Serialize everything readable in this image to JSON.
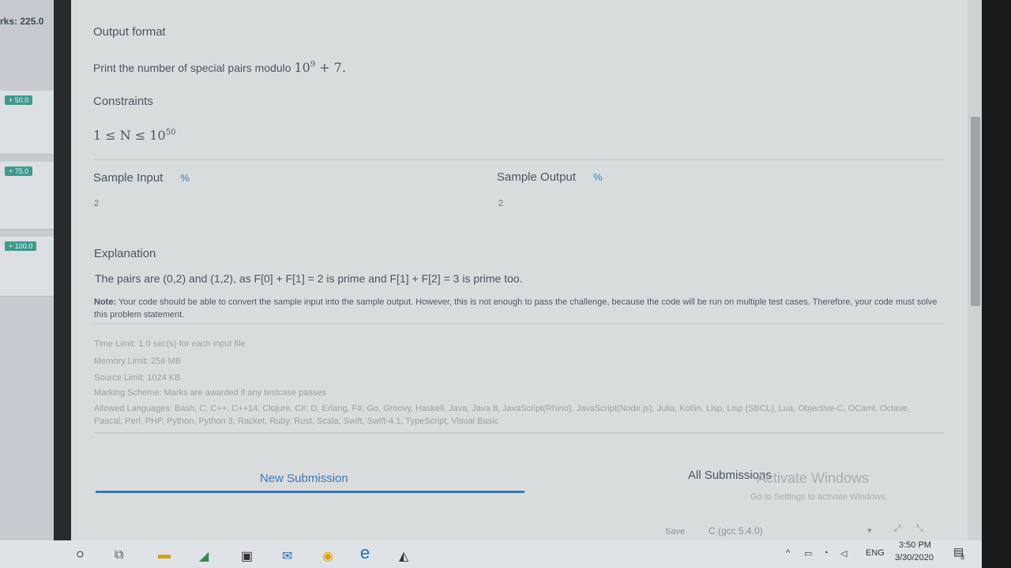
{
  "marks": {
    "total": "rks: 225.0",
    "badges": [
      "+ 50.0",
      "+ 75.0",
      "+ 100.0"
    ]
  },
  "output_format": {
    "heading": "Output format",
    "text": "Print the number of special pairs modulo",
    "expr_base": "10",
    "expr_exp": "9",
    "expr_tail": "+ 7."
  },
  "constraints": {
    "heading": "Constraints",
    "lhs": "1 ≤ N ≤ 10",
    "exp": "50"
  },
  "sample": {
    "input_label": "Sample Input",
    "input_value": "2",
    "output_label": "Sample Output",
    "output_value": "2",
    "link_icon": "%"
  },
  "explanation": {
    "heading": "Explanation",
    "text": "The pairs are (0,2) and (1,2), as F[0] + F[1] = 2 is prime and F[1] + F[2] = 3 is prime too."
  },
  "note": {
    "label": "Note:",
    "text": "Your code should be able to convert the sample input into the sample output. However, this is not enough to pass the challenge, because the code will be run on multiple test cases. Therefore, your code must solve this problem statement."
  },
  "limits": {
    "time": "Time Limit: 1.0 sec(s) for each input file",
    "memory": "Memory Limit: 256 MB",
    "source": "Source Limit: 1024 KB",
    "marking": "Marking Scheme: Marks are awarded if any testcase passes",
    "languages": "Allowed Languages: Bash, C, C++, C++14, Clojure, C#, D, Erlang, F#, Go, Groovy, Haskell, Java, Java 8, JavaScript(Rhino), JavaScript(Node.js), Julia, Kotlin, Lisp, Lisp (SBCL), Lua, Objective-C, OCaml, Octave, Pascal, Perl, PHP, Python, Python 3, Racket, Ruby, Rust, Scala, Swift, Swift-4.1, TypeScript, Visual Basic"
  },
  "tabs": {
    "new_submission": "New Submission",
    "all_submissions": "All Submissions"
  },
  "watermark": {
    "title": "Activate Windows",
    "subtitle": "Go to Settings to activate Windows."
  },
  "editor_peek": {
    "save": "Save",
    "lang": "C (gcc 5.4.0)"
  },
  "taskbar": {
    "lang": "ENG",
    "time": "3:50 PM",
    "date": "3/30/2020",
    "notif_count": "3"
  },
  "colors": {
    "accent": "#3a78b5",
    "badge": "#3f9a8a"
  }
}
